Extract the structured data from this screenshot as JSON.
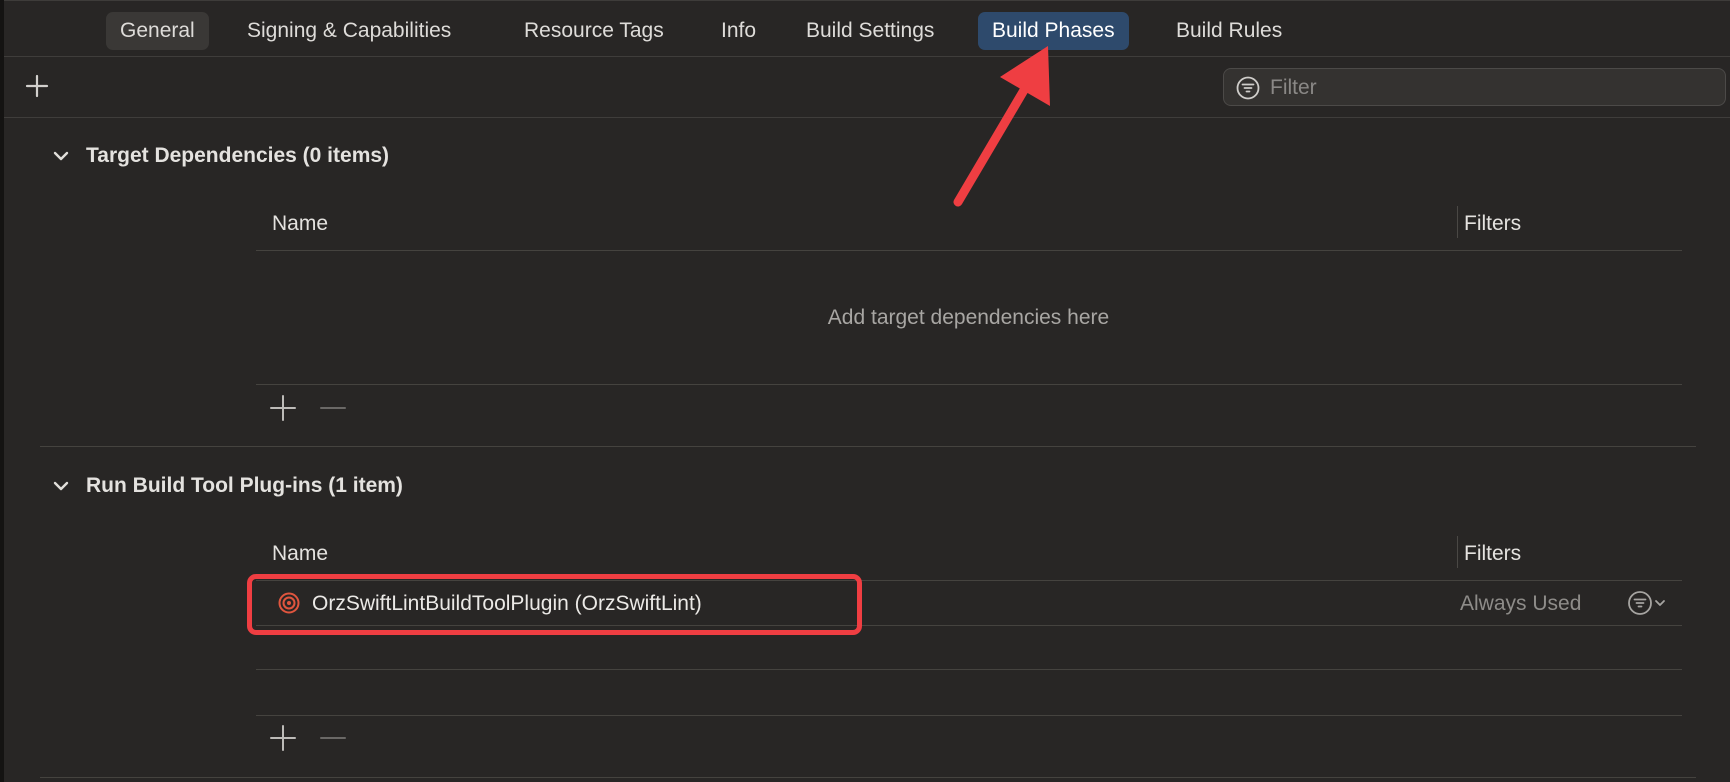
{
  "tabs": [
    {
      "label": "General"
    },
    {
      "label": "Signing & Capabilities"
    },
    {
      "label": "Resource Tags"
    },
    {
      "label": "Info"
    },
    {
      "label": "Build Settings"
    },
    {
      "label": "Build Phases",
      "selected": true
    },
    {
      "label": "Build Rules"
    }
  ],
  "toolbar": {
    "add_icon": "plus-icon",
    "filter_placeholder": "Filter",
    "filter_icon": "filter-circle-icon"
  },
  "sections": [
    {
      "title": "Target Dependencies (0 items)",
      "expanded": true,
      "columns": {
        "name": "Name",
        "filters": "Filters"
      },
      "empty_message": "Add target dependencies here",
      "rows": []
    },
    {
      "title": "Run Build Tool Plug-ins (1 item)",
      "expanded": true,
      "columns": {
        "name": "Name",
        "filters": "Filters"
      },
      "rows": [
        {
          "icon": "plugin-target-icon",
          "name": "OrzSwiftLintBuildToolPlugin (OrzSwiftLint)",
          "filter": "Always Used",
          "filter_menu_icon": "filter-menu-icon"
        }
      ]
    }
  ],
  "colors": {
    "background": "#282625",
    "selected_tab": "#2e4a6c",
    "annotation_red": "#ef3e42",
    "plugin_icon": "#e0553e"
  }
}
